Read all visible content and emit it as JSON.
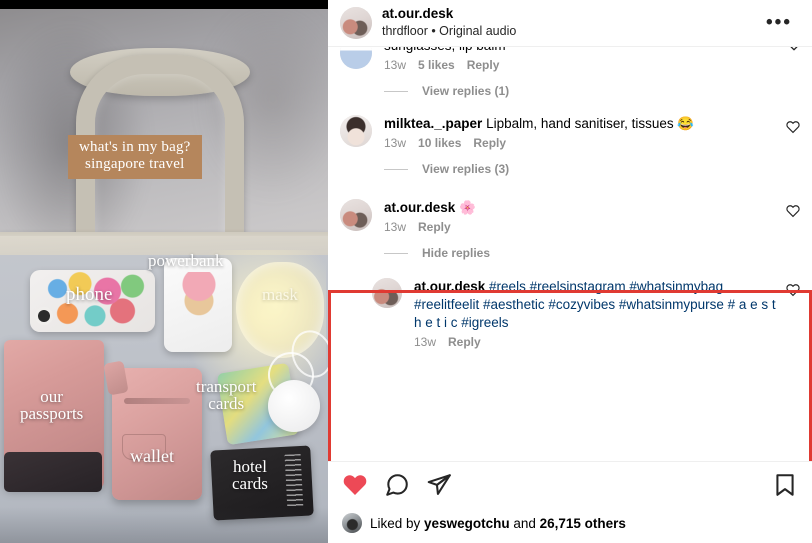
{
  "media": {
    "title_line1": "what's in my bag?",
    "title_line2": "singapore travel",
    "labels": {
      "powerbank": "powerbank",
      "phone": "phone",
      "mask": "mask",
      "passports_line1": "our",
      "passports_line2": "passports",
      "transport_line1": "transport",
      "transport_line2": "cards",
      "wallet": "wallet",
      "hotel_line1": "hotel",
      "hotel_line2": "cards"
    }
  },
  "header": {
    "username": "at.our.desk",
    "audio": "thrdfloor • Original audio",
    "more_label": "•••"
  },
  "comments": [
    {
      "username": "",
      "text": "sunglasses, lip balm",
      "time": "13w",
      "likes": "5 likes",
      "reply": "Reply",
      "view_replies": "View replies (1)"
    },
    {
      "username": "milktea._.paper",
      "text": "Lipbalm, hand sanitiser, tissues 😂",
      "time": "13w",
      "likes": "10 likes",
      "reply": "Reply",
      "view_replies": "View replies (3)"
    },
    {
      "username": "at.our.desk",
      "text": "🌸",
      "time": "13w",
      "likes": "",
      "reply": "Reply",
      "view_replies": "Hide replies"
    }
  ],
  "nested_reply": {
    "username": "at.our.desk",
    "hashtags": "#reels #reelsinstagram #whatsinmybag #reelitfeelit #aesthetic #cozyvibes #whatsinmypurse # a e s t h e t i c #igreels",
    "time": "13w",
    "reply": "Reply"
  },
  "actions": {
    "like_icon": "heart-filled-icon",
    "comment_icon": "comment-icon",
    "share_icon": "share-icon",
    "save_icon": "bookmark-icon",
    "like_color": "#ED4956"
  },
  "likes": {
    "prefix": "Liked by ",
    "user": "yeswegotchu",
    "middle": " and ",
    "count": "26,715 others"
  },
  "annotation": {
    "highlight_color": "#E03A32"
  }
}
